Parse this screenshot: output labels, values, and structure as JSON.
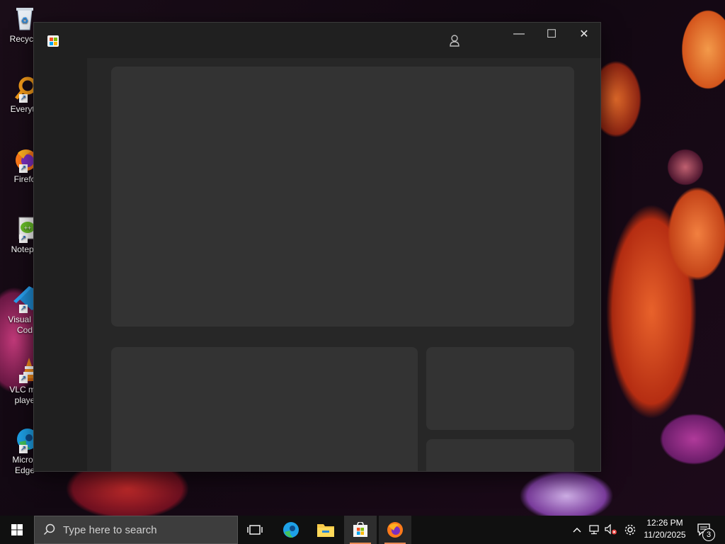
{
  "desktop": {
    "icons": [
      {
        "label": "Recycle",
        "icon": "recycle-bin-icon"
      },
      {
        "label": "Everyth",
        "icon": "everything-search-icon"
      },
      {
        "label": "Firefo",
        "icon": "firefox-icon"
      },
      {
        "label": "Notepa",
        "icon": "notepad-plus-plus-icon"
      },
      {
        "label": "Visual St\nCod",
        "icon": "visual-studio-code-icon"
      },
      {
        "label": "VLC me\nplaye",
        "icon": "vlc-icon"
      },
      {
        "label": "Micros\nEdge",
        "icon": "edge-icon"
      }
    ]
  },
  "window": {
    "app_icon": "microsoft-store-icon",
    "controls": {
      "minimize": "—",
      "maximize": "☐",
      "close": "✕"
    },
    "carousel": {
      "page_count": 4
    }
  },
  "taskbar": {
    "search_placeholder": "Type here to search",
    "pinned": [
      "task-view-icon",
      "edge-icon",
      "file-explorer-icon",
      "microsoft-store-icon",
      "firefox-icon"
    ],
    "time": "12:26 PM",
    "date": "11/20/2025",
    "notification_count": "3"
  },
  "colors": {
    "accent": "#e88a55",
    "window_bg": "#202020",
    "placeholder": "#333333"
  }
}
